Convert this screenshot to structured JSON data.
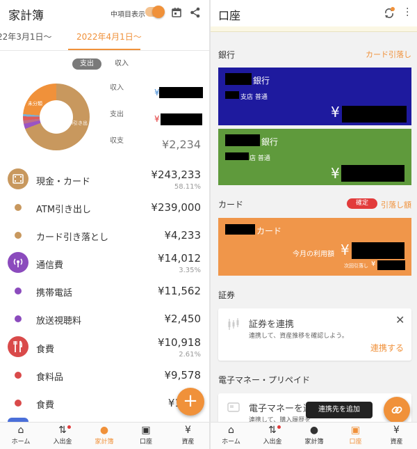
{
  "left": {
    "title": "家計簿",
    "toggle_label": "中項目表示",
    "periods": [
      "22年3月1日〜",
      "2022年4月1日〜"
    ],
    "segments": [
      "支出",
      "収入"
    ],
    "donut": {
      "label_a": "未分類",
      "label_b": "M引き出"
    },
    "summary": {
      "income_label": "収入",
      "income_yen": "¥",
      "expense_label": "支出",
      "expense_yen": "¥",
      "balance_label": "収支",
      "balance": "¥2,234"
    },
    "rows": [
      {
        "name": "現金・カード",
        "amount": "¥243,233",
        "pct": "58.11%",
        "kind": "category",
        "icon": "film-icon",
        "color": "#c8985e"
      },
      {
        "name": "ATM引き出し",
        "amount": "¥239,000",
        "kind": "sub",
        "color": "#c8985e"
      },
      {
        "name": "カード引き落とし",
        "amount": "¥4,233",
        "kind": "sub",
        "color": "#c8985e"
      },
      {
        "name": "通信費",
        "amount": "¥14,012",
        "pct": "3.35%",
        "kind": "category",
        "icon": "antenna-icon",
        "color": "#8b4bbd"
      },
      {
        "name": "携帯電話",
        "amount": "¥11,562",
        "kind": "sub",
        "color": "#8b4bbd"
      },
      {
        "name": "放送視聴料",
        "amount": "¥2,450",
        "kind": "sub",
        "color": "#8b4bbd"
      },
      {
        "name": "食費",
        "amount": "¥10,918",
        "pct": "2.61%",
        "kind": "category",
        "icon": "cutlery-icon",
        "color": "#d94a4a"
      },
      {
        "name": "食料品",
        "amount": "¥9,578",
        "kind": "sub",
        "color": "#d94a4a"
      },
      {
        "name": "食費",
        "amount": "¥1",
        "kind": "sub",
        "color": "#d94a4a"
      }
    ],
    "fab": "+"
  },
  "nav_left": {
    "tabs": [
      {
        "label": "ホーム",
        "icon": "home-icon"
      },
      {
        "label": "入出金",
        "icon": "transfer-icon"
      },
      {
        "label": "家計簿",
        "icon": "piggy-bank-icon"
      },
      {
        "label": "口座",
        "icon": "wallet-icon"
      },
      {
        "label": "資産",
        "icon": "money-bag-icon"
      }
    ],
    "active": "家計簿"
  },
  "right": {
    "title": "口座",
    "bank_section": "銀行",
    "bank_link": "カード引落し",
    "bank1": {
      "name": "銀行",
      "branch": "支店 普通",
      "yen": "¥",
      "color": "#1e1a9e"
    },
    "bank2": {
      "name": "銀行",
      "branch": "店 普通",
      "yen": "¥",
      "color": "#5f9a3c"
    },
    "card_section": "カード",
    "card_badge": "確定",
    "card_link": "引落し額",
    "card1": {
      "name": "カード",
      "usage_label": "今月の利用額",
      "next_label": "次回引落し",
      "yen": "¥",
      "yen_small": "¥",
      "color": "#f0964a"
    },
    "securities_section": "証券",
    "securities_card": {
      "title": "証券を連携",
      "desc": "連携して、資産推移を確認しよう。",
      "action": "連携する"
    },
    "emoney_section": "電子マネー・プリペイド",
    "emoney_card": {
      "title": "電子マネーを連",
      "desc": "連携して、購入履歴を"
    },
    "tooltip": "連携先を追加"
  },
  "nav_right": {
    "tabs": [
      {
        "label": "ホーム",
        "icon": "home-icon"
      },
      {
        "label": "入出金",
        "icon": "transfer-icon"
      },
      {
        "label": "家計簿",
        "icon": "piggy-bank-icon"
      },
      {
        "label": "口座",
        "icon": "wallet-icon"
      },
      {
        "label": "資産",
        "icon": "money-bag-icon"
      }
    ],
    "active": "口座"
  },
  "colors": {
    "accent": "#f0913a",
    "bank_blue": "#1e1a9e",
    "bank_green": "#5f9a3c",
    "card_orange": "#f0964a",
    "badge_red": "#e23b3b"
  }
}
